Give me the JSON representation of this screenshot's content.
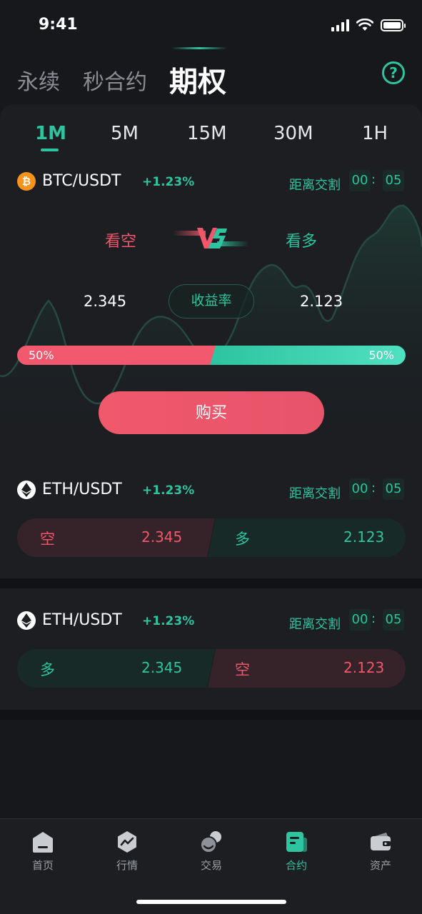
{
  "status_bar": {
    "time": "9:41"
  },
  "top_tabs": [
    "永续",
    "秒合约",
    "期权"
  ],
  "help_icon": "?",
  "intervals": [
    "1M",
    "5M",
    "15M",
    "30M",
    "1H"
  ],
  "featured": {
    "pair": "BTC/USDT",
    "change": "+1.23%",
    "countdown_label": "距离交割",
    "countdown_min": "00",
    "countdown_sep": ":",
    "countdown_sec": "05",
    "side_short": "看空",
    "side_long": "看多",
    "odds_short": "2.345",
    "odds_long": "2.123",
    "yield_label": "收益率",
    "ratio_short": "50%",
    "ratio_long": "50%",
    "ratio_short_value": 0.5,
    "buy_label": "购买"
  },
  "cards": [
    {
      "pair": "ETH/USDT",
      "change": "+1.23%",
      "countdown_label": "距离交割",
      "countdown_min": "00",
      "countdown_sep": ":",
      "countdown_sec": "05",
      "left_label": "空",
      "left_value": "2.345",
      "right_label": "多",
      "right_value": "2.123"
    },
    {
      "pair": "ETH/USDT",
      "change": "+1.23%",
      "countdown_label": "距离交割",
      "countdown_min": "00",
      "countdown_sep": ":",
      "countdown_sec": "05",
      "left_label": "多",
      "left_value": "2.345",
      "right_label": "空",
      "right_value": "2.123"
    }
  ],
  "bottom_nav": [
    "首页",
    "行情",
    "交易",
    "合约",
    "资产"
  ],
  "colors": {
    "accent_green": "#2ec4a0",
    "accent_red": "#f0576a",
    "background": "#16181c",
    "card": "#1c1e22"
  }
}
